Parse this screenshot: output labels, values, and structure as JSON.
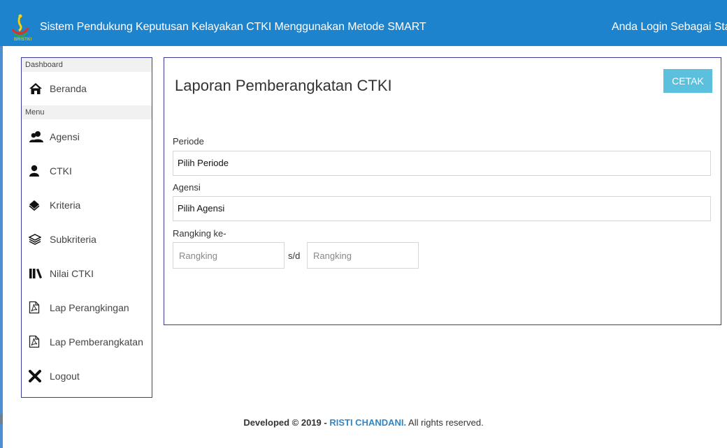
{
  "header": {
    "app_title": "Sistem Pendukung Keputusan Kelayakan CTKI Menggunakan Metode SMART",
    "login_info": "Anda Login Sebagai Staff",
    "logo_text": "BRISTKI"
  },
  "sidebar": {
    "section_dashboard": "Dashboard",
    "section_menu": "Menu",
    "items": [
      {
        "label": "Beranda",
        "icon": "home-icon"
      },
      {
        "label": "Agensi",
        "icon": "users-icon"
      },
      {
        "label": "CTKI",
        "icon": "user-icon"
      },
      {
        "label": "Kriteria",
        "icon": "layer-icon"
      },
      {
        "label": "Subkriteria",
        "icon": "layers-icon"
      },
      {
        "label": "Nilai CTKI",
        "icon": "books-icon"
      },
      {
        "label": "Lap Perangkingan",
        "icon": "pdf-file-icon"
      },
      {
        "label": "Lap Pemberangkatan",
        "icon": "pdf-file-icon"
      },
      {
        "label": "Logout",
        "icon": "close-icon"
      }
    ]
  },
  "main": {
    "title": "Laporan Pemberangkatan CTKI",
    "print_label": "CETAK",
    "period_label": "Periode",
    "period_value": "Pilih Periode",
    "agency_label": "Agensi",
    "agency_value": "Pilih Agensi",
    "rank_label": "Rangking ke-",
    "rank_from_placeholder": "Rangking",
    "rank_separator": "s/d",
    "rank_to_placeholder": "Rangking"
  },
  "footer": {
    "developed": "Developed © 2019 -",
    "author": "RISTI CHANDANI.",
    "rights": "All rights reserved."
  },
  "colors": {
    "topbar": "#1c83cc",
    "print_button": "#5bc0de",
    "border": "#3b3b9e",
    "brand": "#2f86c8"
  }
}
